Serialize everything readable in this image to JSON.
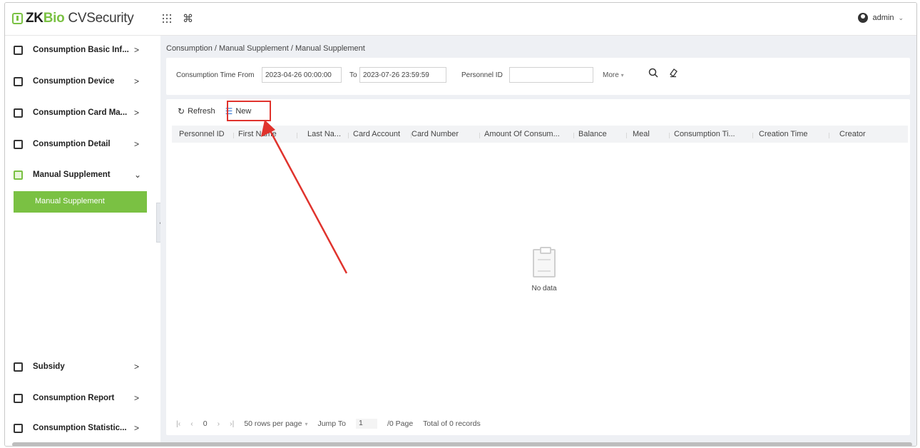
{
  "app": {
    "brand_prefix": "ZK",
    "brand_mid": "Bio",
    "brand_suffix": " CVSecurity",
    "user": "admin"
  },
  "sidebar": {
    "items": [
      {
        "label": "Consumption Basic Inf...",
        "icon": "window-icon"
      },
      {
        "label": "Consumption Device",
        "icon": "device-icon"
      },
      {
        "label": "Consumption Card Ma...",
        "icon": "card-icon"
      },
      {
        "label": "Consumption Detail",
        "icon": "detail-icon"
      },
      {
        "label": "Manual Supplement",
        "icon": "supplement-icon"
      },
      {
        "label": "Subsidy",
        "icon": "subsidy-icon"
      },
      {
        "label": "Consumption Report",
        "icon": "report-icon"
      },
      {
        "label": "Consumption Statistic...",
        "icon": "statistic-icon"
      }
    ],
    "active_sub": "Manual Supplement"
  },
  "breadcrumb": "Consumption / Manual Supplement / Manual Supplement",
  "search": {
    "time_from_label": "Consumption Time From",
    "time_from_value": "2023-04-26 00:00:00",
    "to_label": "To",
    "time_to_value": "2023-07-26 23:59:59",
    "personnel_label": "Personnel ID",
    "personnel_value": "",
    "more_label": "More"
  },
  "toolbar": {
    "refresh_label": "Refresh",
    "new_label": "New"
  },
  "table": {
    "columns": [
      "Personnel ID",
      "First Name",
      "Last Na...",
      "Card Account",
      "Card Number",
      "Amount Of Consum...",
      "Balance",
      "Meal",
      "Consumption Ti...",
      "Creation Time",
      "Creator"
    ],
    "empty_text": "No data"
  },
  "pager": {
    "current_page": "0",
    "rows_per_page": "50 rows per page",
    "jump_label": "Jump To",
    "jump_value": "1",
    "page_total": "/0 Page",
    "total_records": "Total of 0 records"
  },
  "colors": {
    "accent": "#7ac143",
    "annotation": "#e0332d"
  }
}
